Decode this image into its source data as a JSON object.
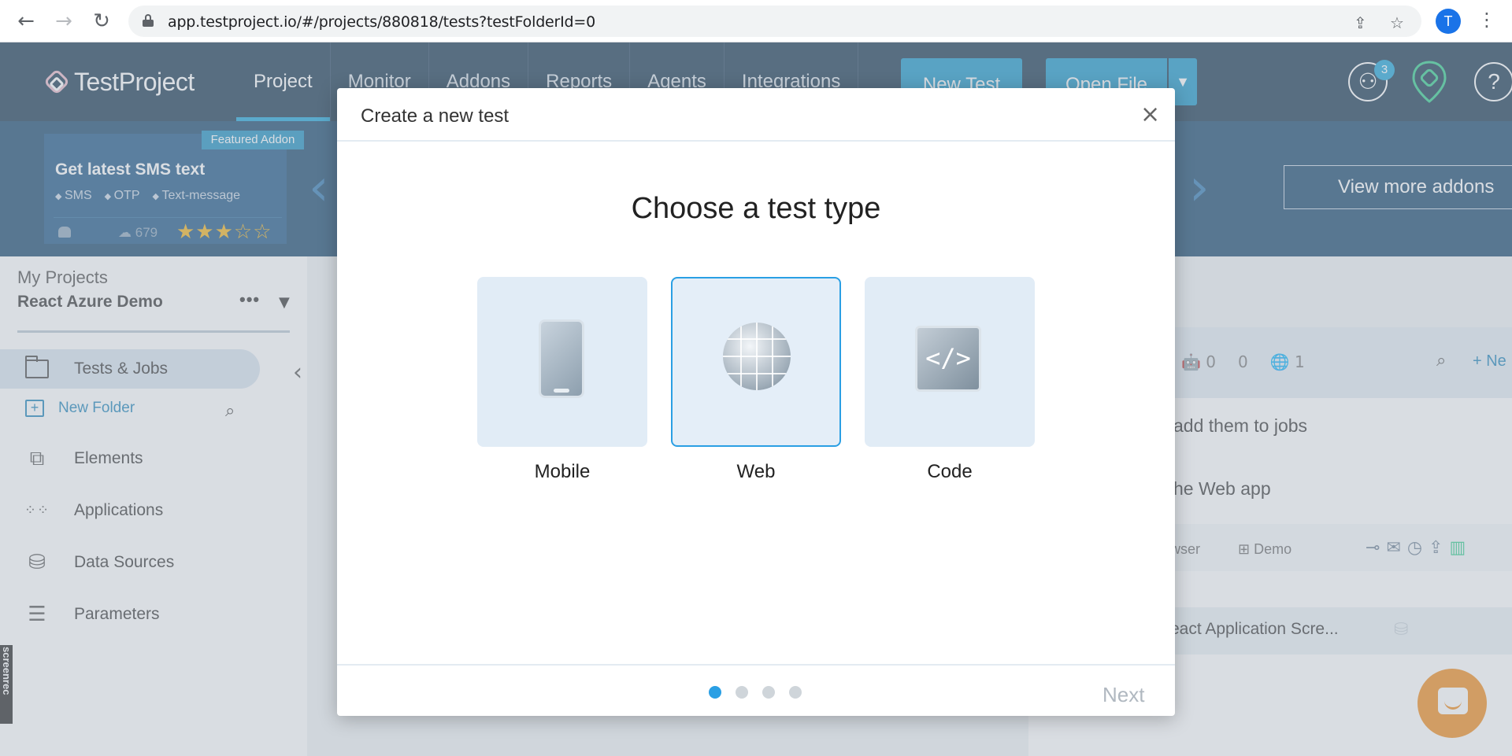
{
  "browser": {
    "back": "←",
    "forward": "→",
    "reload": "↻",
    "url": "app.testproject.io/#/projects/880818/tests?testFolderId=0",
    "share_icon": "share-icon",
    "bookmark_icon": "star-icon",
    "profile_initial": "T",
    "menu": "⋮"
  },
  "header": {
    "logo_text": "TestProject",
    "nav": [
      "Project",
      "Monitor",
      "Addons",
      "Reports",
      "Agents",
      "Integrations"
    ],
    "active_nav": "Project",
    "new_test": "New Test",
    "open_file": "Open File",
    "notification_count": "3",
    "help": "?"
  },
  "banner": {
    "featured_tag": "Featured Addon",
    "addon_title": "Get latest SMS text",
    "tags": [
      "SMS",
      "OTP",
      "Text-message"
    ],
    "downloads": "679",
    "rating_stars": "★★★☆☆",
    "rating": 3,
    "view_more": "View more addons"
  },
  "sidebar": {
    "my_projects": "My Projects",
    "project_name": "React Azure Demo",
    "more": "•••",
    "active_item": "Tests & Jobs",
    "new_folder": "New Folder",
    "items": [
      {
        "label": "Elements",
        "icon": "puzzle-icon"
      },
      {
        "label": "Applications",
        "icon": "grid-icon"
      },
      {
        "label": "Data Sources",
        "icon": "database-icon"
      },
      {
        "label": "Parameters",
        "icon": "sliders-icon"
      }
    ],
    "screenrec": "screenrec"
  },
  "background_panel": {
    "android_count": "0",
    "apple_count": "0",
    "web_count": "1",
    "new_label": "+ Ne",
    "line1": "add them to jobs",
    "line2": "he Web app",
    "browser_label": "wser",
    "os_label": "Demo",
    "job_name": "eact Application Scre..."
  },
  "modal": {
    "title": "Create a new test",
    "close": "×",
    "heading": "Choose a test type",
    "types": [
      {
        "label": "Mobile",
        "icon": "mobile-icon",
        "selected": false
      },
      {
        "label": "Web",
        "icon": "globe-icon",
        "selected": true
      },
      {
        "label": "Code",
        "icon": "code-icon",
        "selected": false
      }
    ],
    "code_glyph": "</>",
    "steps": 4,
    "current_step": 1,
    "next": "Next"
  }
}
